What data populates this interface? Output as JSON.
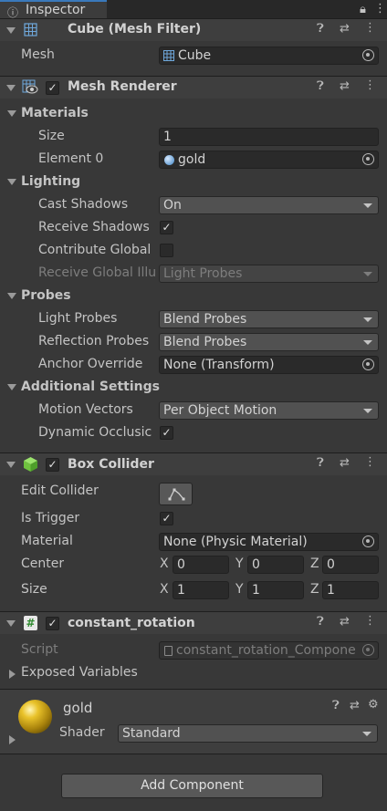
{
  "tab": {
    "title": "Inspector"
  },
  "mesh_filter": {
    "title": "Cube (Mesh Filter)",
    "mesh_label": "Mesh",
    "mesh_value": "Cube"
  },
  "mesh_renderer": {
    "title": "Mesh Renderer",
    "materials": {
      "section": "Materials",
      "size_label": "Size",
      "size_value": "1",
      "element0_label": "Element 0",
      "element0_value": "gold"
    },
    "lighting": {
      "section": "Lighting",
      "cast_label": "Cast Shadows",
      "cast_value": "On",
      "receive_label": "Receive Shadows",
      "contribute_label": "Contribute Global",
      "receive_gi_label": "Receive Global Illu",
      "receive_gi_value": "Light Probes"
    },
    "probes": {
      "section": "Probes",
      "light_label": "Light Probes",
      "light_value": "Blend Probes",
      "reflection_label": "Reflection Probes",
      "reflection_value": "Blend Probes",
      "anchor_label": "Anchor Override",
      "anchor_value": "None (Transform)"
    },
    "additional": {
      "section": "Additional Settings",
      "motion_label": "Motion Vectors",
      "motion_value": "Per Object Motion",
      "dynamic_label": "Dynamic Occlusic"
    }
  },
  "box_collider": {
    "title": "Box Collider",
    "edit_label": "Edit Collider",
    "trigger_label": "Is Trigger",
    "material_label": "Material",
    "material_value": "None (Physic Material)",
    "center_label": "Center",
    "center": {
      "x": "0",
      "y": "0",
      "z": "0"
    },
    "size_label": "Size",
    "size": {
      "x": "1",
      "y": "1",
      "z": "1"
    },
    "axis": {
      "x": "X",
      "y": "Y",
      "z": "Z"
    }
  },
  "script_comp": {
    "title": "constant_rotation",
    "script_label": "Script",
    "script_value": "constant_rotation_Compone",
    "exposed_label": "Exposed Variables"
  },
  "material": {
    "name": "gold",
    "shader_label": "Shader",
    "shader_value": "Standard"
  },
  "add_component": {
    "label": "Add Component"
  },
  "colors": {
    "accent": "#3a79bb",
    "gold": "#c9a414",
    "bg": "#383838"
  }
}
